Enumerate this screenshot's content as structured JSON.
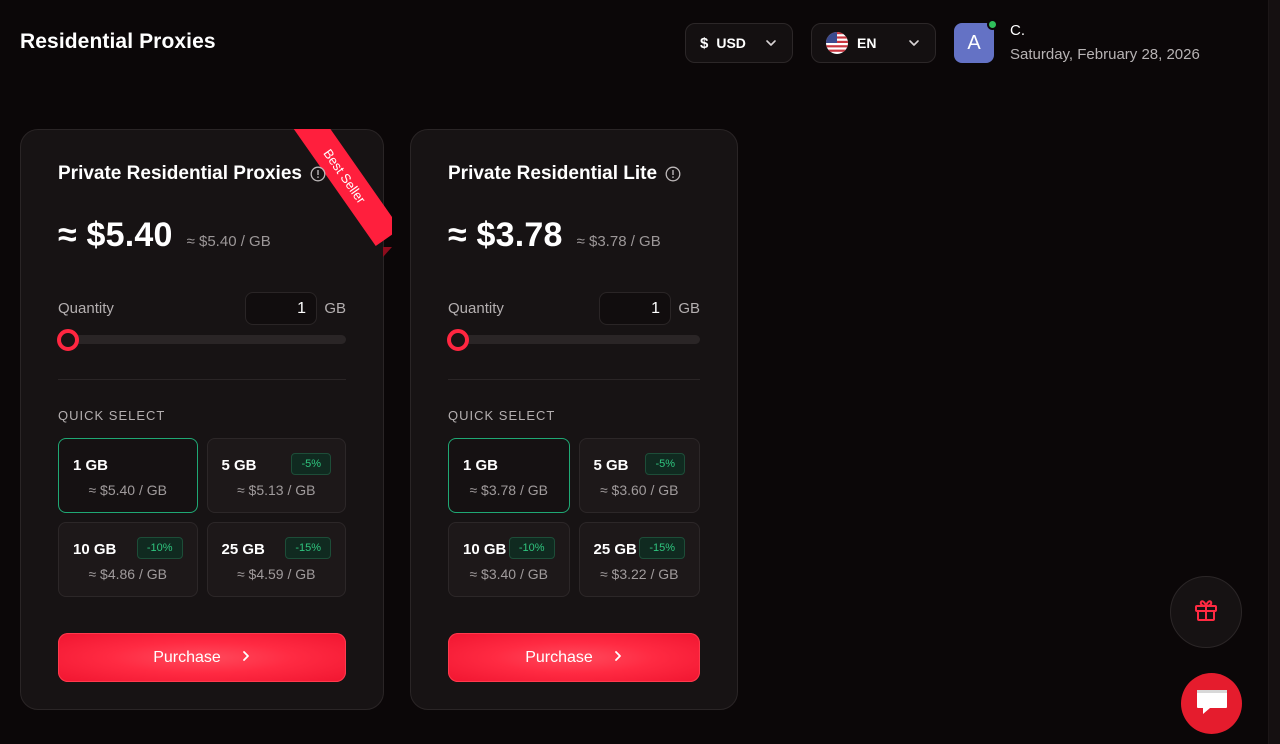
{
  "page": {
    "title": "Residential Proxies"
  },
  "header": {
    "currency": {
      "symbol": "$",
      "code": "USD"
    },
    "language": {
      "code": "EN",
      "flag_icon": "us-flag-icon"
    },
    "user": {
      "avatar_letter": "A",
      "name": "C.",
      "date": "Saturday, February 28, 2026",
      "status_color": "#2fbf5b"
    }
  },
  "plans": [
    {
      "title": "Private Residential Proxies",
      "ribbon": "Best Seller",
      "price": "≈ $5.40",
      "price_per_unit": "≈ $5.40 / GB",
      "quantity_label": "Quantity",
      "quantity_value": "1",
      "quantity_unit": "GB",
      "slider_level": 0,
      "quick_select_label": "QUICK SELECT",
      "options": [
        {
          "gb": "1 GB",
          "price": "≈ $5.40 / GB",
          "badge": "",
          "selected": true
        },
        {
          "gb": "5 GB",
          "price": "≈ $5.13 / GB",
          "badge": "-5%",
          "selected": false
        },
        {
          "gb": "10 GB",
          "price": "≈ $4.86 / GB",
          "badge": "-10%",
          "selected": false
        },
        {
          "gb": "25 GB",
          "price": "≈ $4.59 / GB",
          "badge": "-15%",
          "selected": false
        }
      ],
      "purchase_label": "Purchase"
    },
    {
      "title": "Private Residential Lite",
      "price": "≈ $3.78",
      "price_per_unit": "≈ $3.78 / GB",
      "quantity_label": "Quantity",
      "quantity_value": "1",
      "quantity_unit": "GB",
      "slider_level": 0,
      "quick_select_label": "QUICK SELECT",
      "options": [
        {
          "gb": "1 GB",
          "price": "≈ $3.78 / GB",
          "badge": "",
          "selected": true
        },
        {
          "gb": "5 GB",
          "price": "≈ $3.60 / GB",
          "badge": "-5%",
          "selected": false
        },
        {
          "gb": "10 GB",
          "price": "≈ $3.40 / GB",
          "badge": "-10%",
          "selected": false
        },
        {
          "gb": "25 GB",
          "price": "≈ $3.22 / GB",
          "badge": "-15%",
          "selected": false
        }
      ],
      "purchase_label": "Purchase"
    }
  ],
  "floating": {
    "gift_icon": "gift-icon",
    "chat_icon": "chat-icon"
  },
  "colors": {
    "accent": "#ff2640",
    "selected_border": "#1fa874",
    "badge_text": "#2fc47e",
    "background": "#0b0708"
  }
}
